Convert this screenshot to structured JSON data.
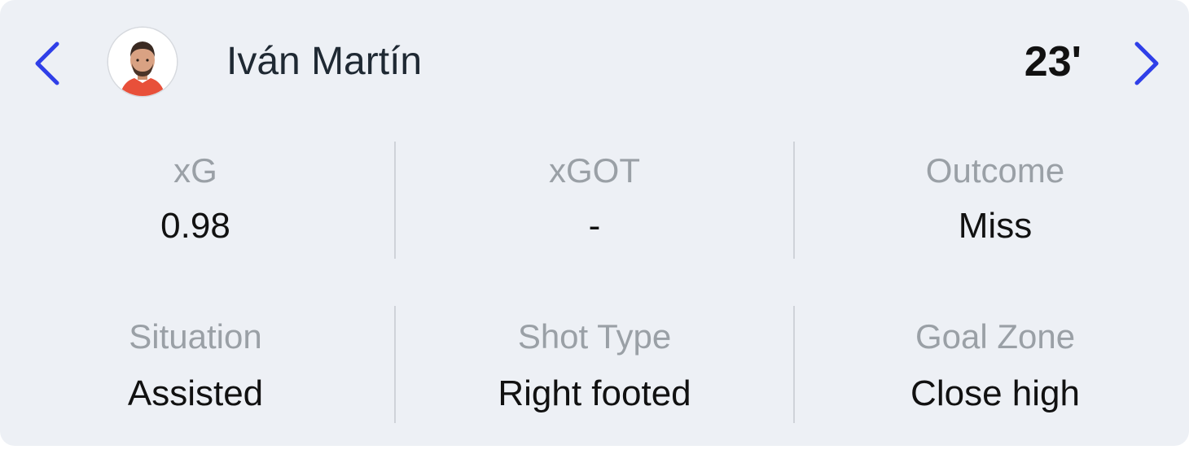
{
  "shot": {
    "player_name": "Iván Martín",
    "minute": "23'",
    "nav": {
      "prev_icon": "chevron-left-icon",
      "next_icon": "chevron-right-icon",
      "accent_color": "#2f3fe8"
    },
    "stats_row_1": [
      {
        "label": "xG",
        "value": "0.98"
      },
      {
        "label": "xGOT",
        "value": "-"
      },
      {
        "label": "Outcome",
        "value": "Miss"
      }
    ],
    "stats_row_2": [
      {
        "label": "Situation",
        "value": "Assisted"
      },
      {
        "label": "Shot Type",
        "value": "Right footed"
      },
      {
        "label": "Goal Zone",
        "value": "Close high"
      }
    ]
  }
}
